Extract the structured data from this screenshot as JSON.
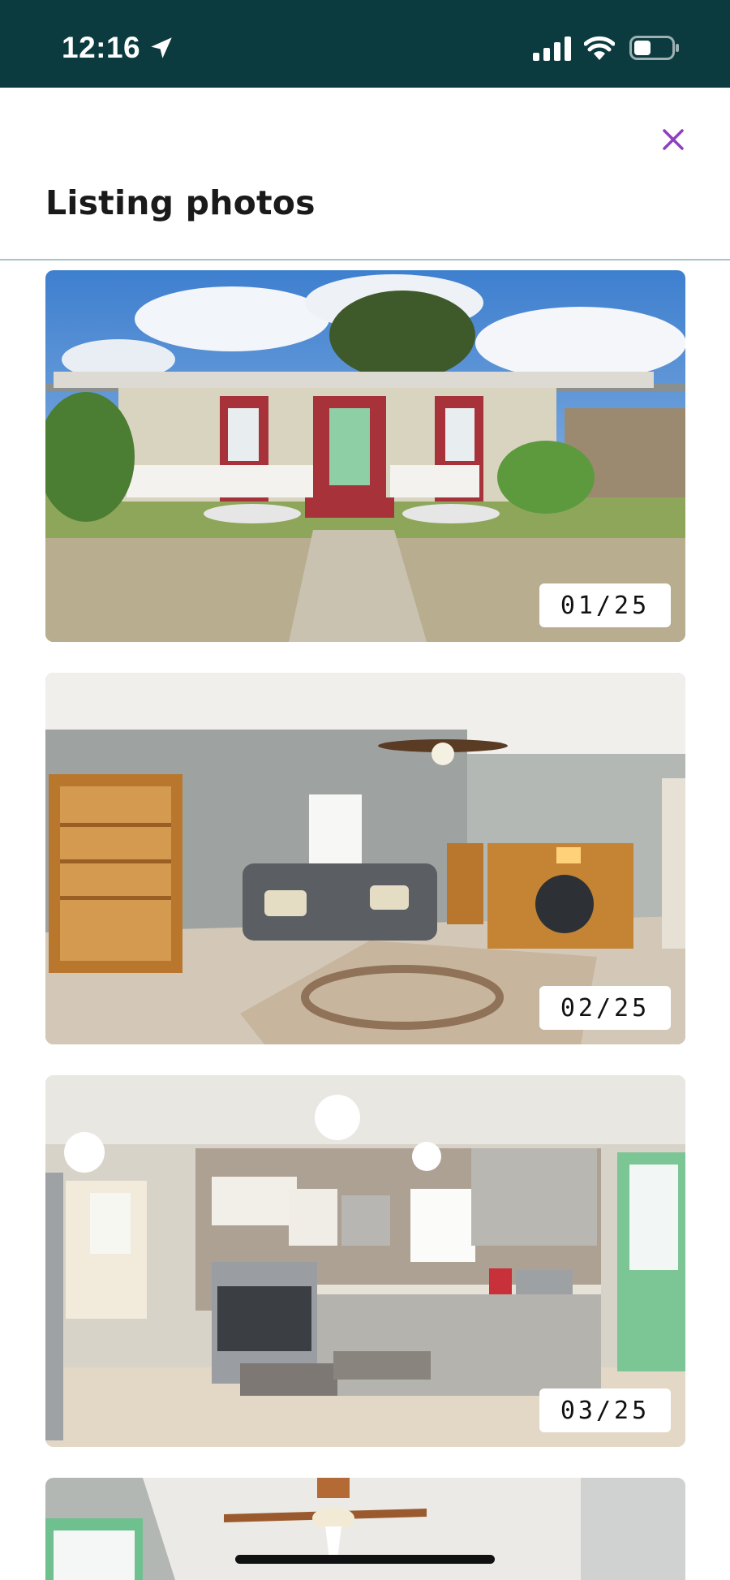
{
  "status_bar": {
    "time": "12:16",
    "icons": [
      "location-arrow-icon",
      "cellular-signal-icon",
      "wifi-icon",
      "battery-icon"
    ]
  },
  "header": {
    "title": "Listing photos",
    "close_icon": "close-icon",
    "close_color": "#8e3fbf"
  },
  "photos": [
    {
      "counter": "01/25",
      "subject": "exterior"
    },
    {
      "counter": "02/25",
      "subject": "living-room"
    },
    {
      "counter": "03/25",
      "subject": "kitchen"
    },
    {
      "counter": "",
      "subject": "room-with-ceiling-fan"
    }
  ],
  "colors": {
    "status_bar_bg": "#0b3b3f",
    "divider": "#a9c3cb"
  }
}
